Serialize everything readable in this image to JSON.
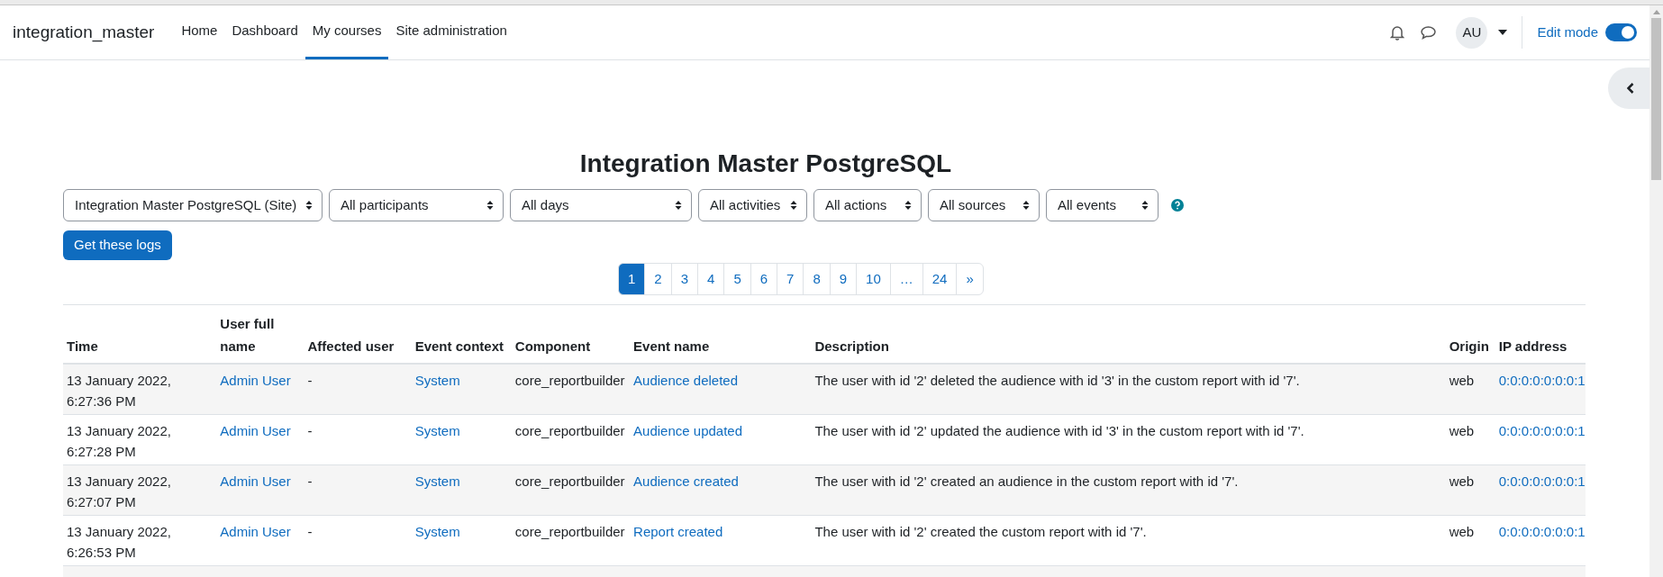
{
  "navbar": {
    "site_name": "integration_master",
    "items": [
      {
        "label": "Home",
        "selected": false
      },
      {
        "label": "Dashboard",
        "selected": false
      },
      {
        "label": "My courses",
        "selected": true
      },
      {
        "label": "Site administration",
        "selected": false
      }
    ],
    "avatar": "AU",
    "edit_mode": {
      "label": "Edit mode",
      "on": true
    }
  },
  "page_title": "Integration Master PostgreSQL",
  "filters": [
    {
      "value": "Integration Master PostgreSQL (Site)"
    },
    {
      "value": "All participants"
    },
    {
      "value": "All days"
    },
    {
      "value": "All activities"
    },
    {
      "value": "All actions"
    },
    {
      "value": "All sources"
    },
    {
      "value": "All events"
    }
  ],
  "submit_button": "Get these logs",
  "pagination": [
    {
      "label": "1",
      "selected": true
    },
    {
      "label": "2",
      "selected": false
    },
    {
      "label": "3",
      "selected": false
    },
    {
      "label": "4",
      "selected": false
    },
    {
      "label": "5",
      "selected": false
    },
    {
      "label": "6",
      "selected": false
    },
    {
      "label": "7",
      "selected": false
    },
    {
      "label": "8",
      "selected": false
    },
    {
      "label": "9",
      "selected": false
    },
    {
      "label": "10",
      "selected": false
    },
    {
      "label": "…",
      "selected": false
    },
    {
      "label": "24",
      "selected": false
    },
    {
      "label": "»",
      "selected": false
    }
  ],
  "table": {
    "columns": [
      "Time",
      "User full name",
      "Affected user",
      "Event context",
      "Component",
      "Event name",
      "Description",
      "Origin",
      "IP address"
    ],
    "rows": [
      {
        "time": "13 January 2022, 6:27:36 PM",
        "user": "Admin User",
        "affected_user": "-",
        "context": "System",
        "component": "core_reportbuilder",
        "event_name": "Audience deleted",
        "description": "The user with id '2' deleted the audience with id '3' in the custom report with id '7'.",
        "origin": "web",
        "ip": "0:0:0:0:0:0:0:1"
      },
      {
        "time": "13 January 2022, 6:27:28 PM",
        "user": "Admin User",
        "affected_user": "-",
        "context": "System",
        "component": "core_reportbuilder",
        "event_name": "Audience updated",
        "description": "The user with id '2' updated the audience with id '3' in the custom report with id '7'.",
        "origin": "web",
        "ip": "0:0:0:0:0:0:0:1"
      },
      {
        "time": "13 January 2022, 6:27:07 PM",
        "user": "Admin User",
        "affected_user": "-",
        "context": "System",
        "component": "core_reportbuilder",
        "event_name": "Audience created",
        "description": "The user with id '2' created an audience in the custom report with id '7'.",
        "origin": "web",
        "ip": "0:0:0:0:0:0:0:1"
      },
      {
        "time": "13 January 2022, 6:26:53 PM",
        "user": "Admin User",
        "affected_user": "-",
        "context": "System",
        "component": "core_reportbuilder",
        "event_name": "Report created",
        "description": "The user with id '2' created the custom report with id '7'.",
        "origin": "web",
        "ip": "0:0:0:0:0:0:0:1"
      }
    ]
  }
}
